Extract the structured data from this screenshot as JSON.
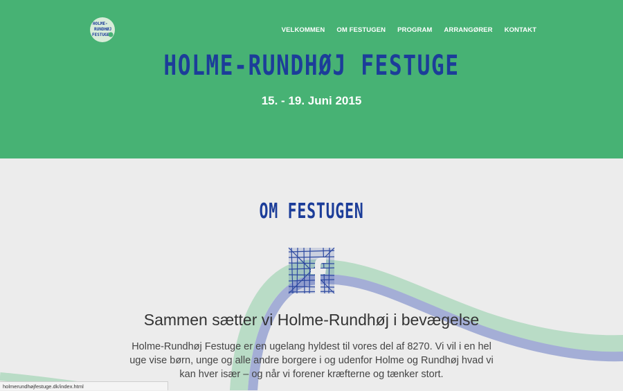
{
  "logo": {
    "text_line1": "HOLME-",
    "text_line2": "RUNDHØJ",
    "text_line3": "FESTUGE"
  },
  "nav": {
    "items": [
      {
        "label": "VELKOMMEN"
      },
      {
        "label": "OM FESTUGEN"
      },
      {
        "label": "PROGRAM"
      },
      {
        "label": "ARRANGØRER"
      },
      {
        "label": "KONTAKT"
      }
    ]
  },
  "hero": {
    "title": "HOLME-RUNDHØJ FESTUGE",
    "date": "15. - 19. Juni 2015"
  },
  "section": {
    "title": "OM FESTUGEN",
    "headline": "Sammen sætter vi Holme-Rundhøj i bevægelse",
    "body": "Holme-Rundhøj Festuge er en ugelang hyldest til vores del af 8270. Vi vil i en hel uge vise børn, unge og alle andre borgere i og udenfor Holme og Rundhøj hvad vi kan hver især – og når vi forener kræfterne og tænker stort."
  },
  "status": {
    "url": "holmerundhøjfestuge.dk/index.html"
  },
  "colors": {
    "hero_bg": "#47b274",
    "accent_blue": "#1c3d99",
    "page_bg": "#ececec",
    "wave_green": "#b9dcc6",
    "wave_blue": "#a4aed6"
  },
  "icons": {
    "facebook": "facebook-icon",
    "logo": "festival-logo"
  }
}
